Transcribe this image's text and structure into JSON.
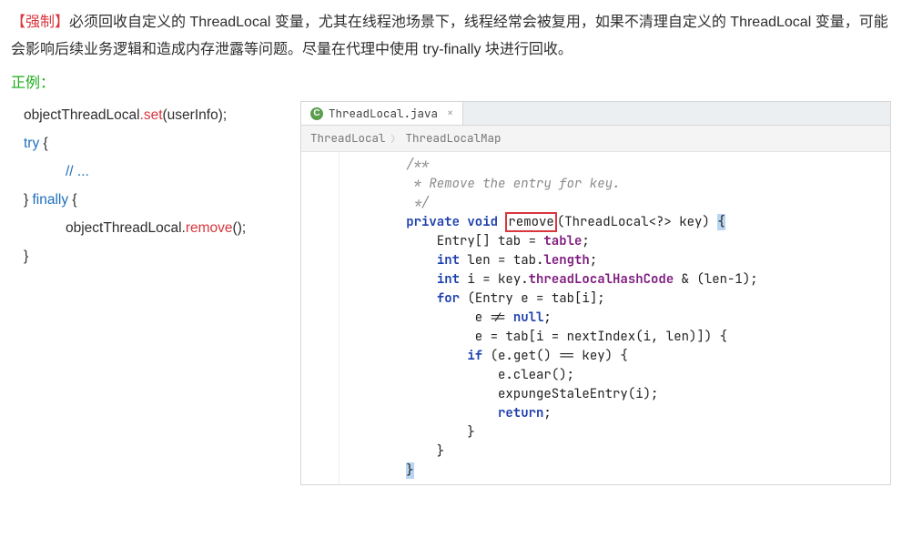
{
  "rule": {
    "tag": "【强制】",
    "text": "必须回收自定义的 ThreadLocal 变量，尤其在线程池场景下，线程经常会被复用，如果不清理自定义的 ThreadLocal 变量，可能会影响后续业务逻辑和造成内存泄露等问题。尽量在代理中使用 try-finally 块进行回收。"
  },
  "example_label": "正例：",
  "snippet": {
    "l1_a": "objectThreadLocal",
    "l1_b": ".set",
    "l1_c": "(userInfo);",
    "l2_a": "try",
    "l2_b": " {",
    "l3": "// ...",
    "l4_a": "} ",
    "l4_b": "finally",
    "l4_c": " {",
    "l5_a": "objectThreadLocal.",
    "l5_b": "remove",
    "l5_c": "();",
    "l6": "}"
  },
  "ide": {
    "tab_label": "ThreadLocal.java",
    "tab_icon": "C",
    "breadcrumb_1": "ThreadLocal",
    "breadcrumb_2": "ThreadLocalMap",
    "code": {
      "c0": "        /**",
      "c1": "         * Remove the entry for key.",
      "c2": "         */",
      "c3a": "        ",
      "c3b": "private void ",
      "c3c": "remove",
      "c3d": "(ThreadLocal<?> key) ",
      "c3e": "{",
      "c4a": "            Entry[] tab = ",
      "c4b": "table",
      "c4c": ";",
      "c5a": "            ",
      "c5b": "int",
      "c5c": " len = tab.",
      "c5d": "length",
      "c5e": ";",
      "c6a": "            ",
      "c6b": "int",
      "c6c": " i = key.",
      "c6d": "threadLocalHashCode",
      "c6e": " & (len-1);",
      "c7a": "            ",
      "c7b": "for",
      "c7c": " (Entry e = tab[i];",
      "c8": "                 e != ",
      "c8b": "null",
      "c8c": ";",
      "c9": "                 e = tab[i = nextIndex(i, len)]) {",
      "c10a": "                ",
      "c10b": "if",
      "c10c": " (e.get() == key) {",
      "c11": "                    e.clear();",
      "c12": "                    expungeStaleEntry(i);",
      "c13a": "                    ",
      "c13b": "return",
      "c13c": ";",
      "c14": "                }",
      "c15": "            }",
      "c16": "        ",
      "c16b": "}"
    }
  }
}
